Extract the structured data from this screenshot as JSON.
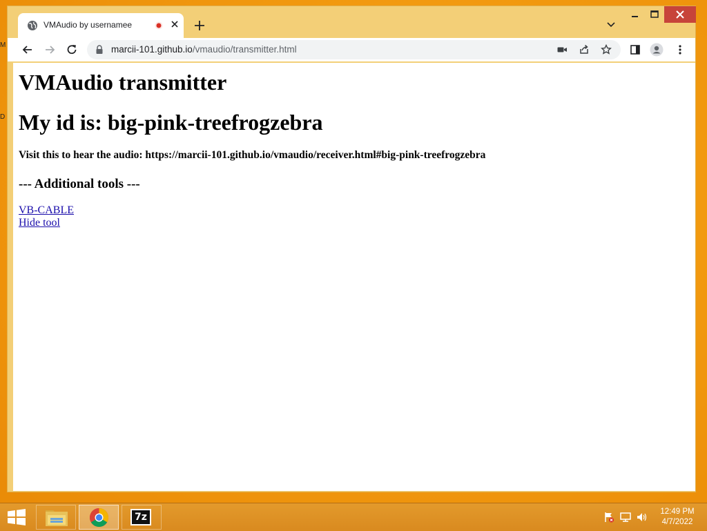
{
  "desktop": {
    "glyph_top": "M",
    "glyph_mid": "D"
  },
  "browser": {
    "tab": {
      "title": "VMAudio by usernamee"
    },
    "address_bar": {
      "host": "marcii-101.github.io",
      "path": "/vmaudio/transmitter.html"
    }
  },
  "page": {
    "heading": "VMAudio transmitter",
    "id_heading": "My id is: big-pink-treefrogzebra",
    "visit_text": "Visit this to hear the audio: https://marcii-101.github.io/vmaudio/receiver.html#big-pink-treefrogzebra",
    "tools_heading": "--- Additional tools ---",
    "links": [
      "VB-CABLE",
      "Hide tool"
    ]
  },
  "taskbar": {
    "apps": [
      "file-explorer",
      "google-chrome",
      "7-zip"
    ],
    "seven_zip_label": "7z",
    "clock": {
      "time": "12:49 PM",
      "date": "4/7/2022"
    }
  },
  "colors": {
    "window_frame": "#f3cf77",
    "taskbar": "#dd8f24",
    "link": "#1a0dab",
    "close_button": "#c7443a"
  }
}
